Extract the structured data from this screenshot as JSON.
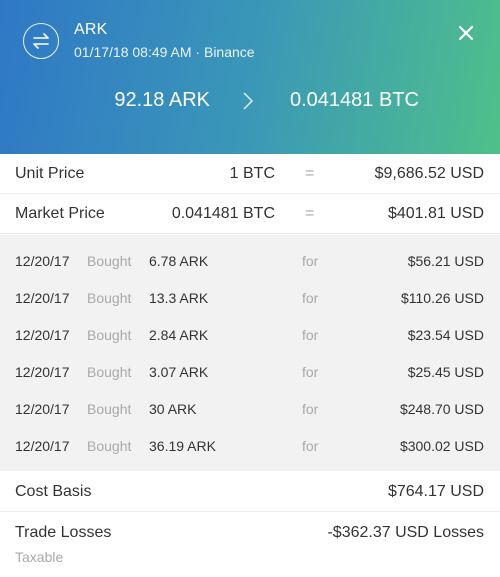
{
  "header": {
    "icon": "swap-arrows-icon",
    "title": "ARK",
    "subtitle": "01/17/18 08:49 AM · Binance",
    "close_icon": "close-icon",
    "from_amount": "92.18 ARK",
    "arrow_icon": "chevron-right-icon",
    "to_amount": "0.041481 BTC",
    "gradient": [
      "#2f78c6",
      "#4fc08a"
    ]
  },
  "prices": [
    {
      "label": "Unit Price",
      "qty": "1 BTC",
      "eq": "=",
      "value": "$9,686.52 USD"
    },
    {
      "label": "Market Price",
      "qty": "0.041481 BTC",
      "eq": "=",
      "value": "$401.81 USD"
    }
  ],
  "trades": [
    {
      "date": "12/20/17",
      "verb": "Bought",
      "amount": "6.78 ARK",
      "for": "for",
      "cost": "$56.21 USD"
    },
    {
      "date": "12/20/17",
      "verb": "Bought",
      "amount": "13.3 ARK",
      "for": "for",
      "cost": "$110.26 USD"
    },
    {
      "date": "12/20/17",
      "verb": "Bought",
      "amount": "2.84 ARK",
      "for": "for",
      "cost": "$23.54 USD"
    },
    {
      "date": "12/20/17",
      "verb": "Bought",
      "amount": "3.07 ARK",
      "for": "for",
      "cost": "$25.45 USD"
    },
    {
      "date": "12/20/17",
      "verb": "Bought",
      "amount": "30 ARK",
      "for": "for",
      "cost": "$248.70 USD"
    },
    {
      "date": "12/20/17",
      "verb": "Bought",
      "amount": "36.19 ARK",
      "for": "for",
      "cost": "$300.02 USD"
    }
  ],
  "cost_basis": {
    "label": "Cost Basis",
    "value": "$764.17 USD"
  },
  "trade_losses": {
    "label": "Trade Losses",
    "value": "-$362.37 USD Losses",
    "note": "Taxable"
  }
}
